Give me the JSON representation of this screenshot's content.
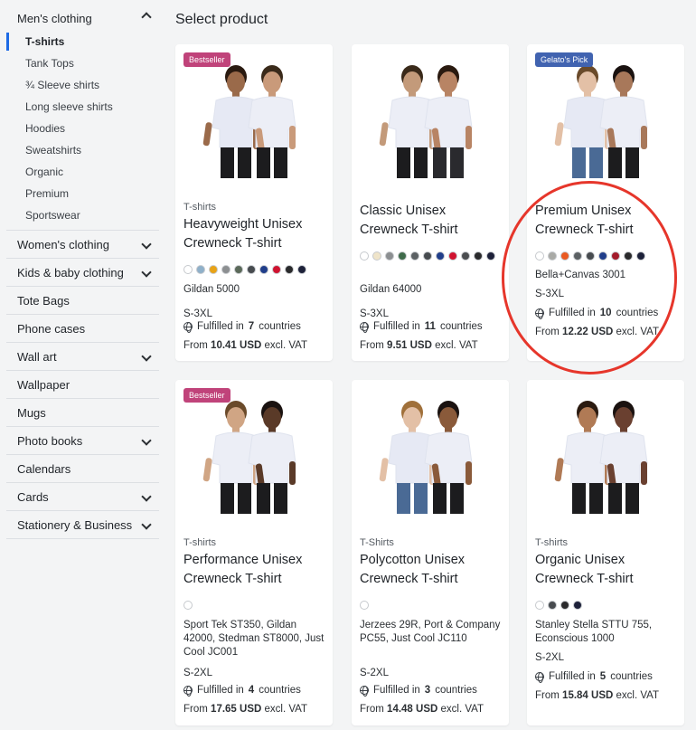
{
  "sidebar": {
    "open_category": "Men's clothing",
    "subitems": [
      "T-shirts",
      "Tank Tops",
      "¾ Sleeve shirts",
      "Long sleeve shirts",
      "Hoodies",
      "Sweatshirts",
      "Organic",
      "Premium",
      "Sportswear"
    ],
    "active_subitem": "T-shirts",
    "categories": [
      {
        "label": "Women's clothing",
        "expandable": true
      },
      {
        "label": "Kids & baby clothing",
        "expandable": true
      },
      {
        "label": "Tote Bags",
        "expandable": false
      },
      {
        "label": "Phone cases",
        "expandable": false
      },
      {
        "label": "Wall art",
        "expandable": true
      },
      {
        "label": "Wallpaper",
        "expandable": false
      },
      {
        "label": "Mugs",
        "expandable": false
      },
      {
        "label": "Photo books",
        "expandable": true
      },
      {
        "label": "Calendars",
        "expandable": false
      },
      {
        "label": "Cards",
        "expandable": true
      },
      {
        "label": "Stationery & Business",
        "expandable": true
      }
    ]
  },
  "main": {
    "title": "Select product",
    "fulfilled_prefix": "Fulfilled in",
    "countries_word": "countries",
    "price_prefix": "From",
    "price_suffix": "excl. VAT",
    "products": [
      {
        "badge": "Bestseller",
        "badge_color": "#c0437a",
        "category": "T-shirts",
        "name": "Heavyweight Unisex Crewneck T-shirt",
        "colors": [
          "#ffffff",
          "#8fb0c9",
          "#e8a317",
          "#8c8f91",
          "#5b6a5a",
          "#474b4f",
          "#203e8a",
          "#d01330",
          "#2a2a2c",
          "#1d2139"
        ],
        "brand": "Gildan 5000",
        "sizes": "S-3XL",
        "countries": "7",
        "price": "10.41 USD"
      },
      {
        "badge": "",
        "badge_color": "",
        "category": "",
        "name": "Classic Unisex Crewneck T-shirt",
        "colors": [
          "#ffffff",
          "#efe4c9",
          "#8c8f91",
          "#3f6b4a",
          "#5b6063",
          "#474b4f",
          "#203e8a",
          "#d01330",
          "#4a4d50",
          "#2a2a2c",
          "#1d2139"
        ],
        "brand": "Gildan 64000",
        "sizes": "S-3XL",
        "countries": "11",
        "price": "9.51 USD"
      },
      {
        "badge": "Gelato's Pick",
        "badge_color": "#4163b0",
        "category": "",
        "name": "Premium Unisex Crewneck T-shirt",
        "colors": [
          "#ffffff",
          "#a9aaa6",
          "#ea5a22",
          "#5b6063",
          "#474b4f",
          "#203e8a",
          "#a31b2b",
          "#2a2a2c",
          "#1d2139"
        ],
        "brand": "Bella+Canvas 3001",
        "sizes": "S-3XL",
        "countries": "10",
        "price": "12.22 USD"
      },
      {
        "badge": "Bestseller",
        "badge_color": "#c0437a",
        "category": "T-shirts",
        "name": "Performance Unisex Crewneck T-shirt",
        "colors": [
          "#ffffff"
        ],
        "brand": "Sport Tek ST350, Gildan 42000, Stedman ST8000, Just Cool JC001",
        "sizes": "S-2XL",
        "countries": "4",
        "price": "17.65 USD"
      },
      {
        "badge": "",
        "badge_color": "",
        "category": "T-Shirts",
        "name": "Polycotton Unisex Crewneck T-shirt",
        "colors": [
          "#ffffff"
        ],
        "brand": "Jerzees 29R, Port & Company PC55, Just Cool JC110",
        "sizes": "S-2XL",
        "countries": "3",
        "price": "14.48 USD"
      },
      {
        "badge": "",
        "badge_color": "",
        "category": "T-shirts",
        "name": "Organic Unisex Crewneck T-shirt",
        "colors": [
          "#ffffff",
          "#474b4f",
          "#2a2a2c",
          "#1d2139"
        ],
        "brand": "Stanley Stella STTU 755, Econscious 1000",
        "sizes": "S-2XL",
        "countries": "5",
        "price": "15.84 USD"
      }
    ]
  }
}
